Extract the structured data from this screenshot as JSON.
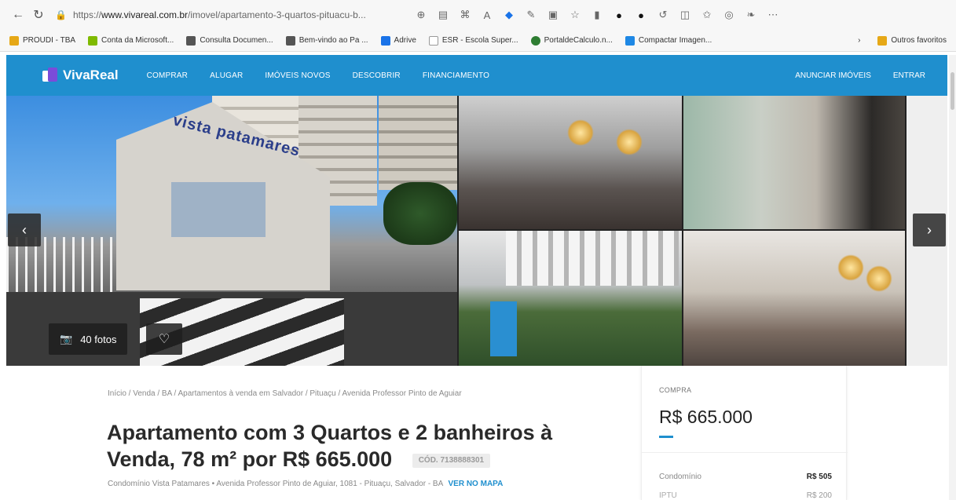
{
  "browser": {
    "url_prefix": "https://",
    "url_domain": "www.vivareal.com.br",
    "url_path": "/imovel/apartamento-3-quartos-pituacu-b..."
  },
  "bookmarks": [
    {
      "label": "PROUDI - TBA",
      "color": "#e6a817"
    },
    {
      "label": "Conta da Microsoft...",
      "color": "#7fba00"
    },
    {
      "label": "Consulta Documen...",
      "color": "#555555"
    },
    {
      "label": "Bem-vindo ao Pa ...",
      "color": "#555555"
    },
    {
      "label": "Adrive",
      "color": "#1a73e8"
    },
    {
      "label": "ESR - Escola Super...",
      "color": "#cccccc"
    },
    {
      "label": "PortaldeCalculo.n...",
      "color": "#2e7d32"
    },
    {
      "label": "Compactar Imagen...",
      "color": "#1e88e5"
    }
  ],
  "bookmarks_more": "Outros favoritos",
  "site": {
    "logo": "VivaReal",
    "nav": [
      "COMPRAR",
      "ALUGAR",
      "IMÓVEIS NOVOS",
      "DESCOBRIR",
      "FINANCIAMENTO"
    ],
    "nav_right": [
      "ANUNCIAR IMÓVEIS",
      "ENTRAR"
    ]
  },
  "gallery": {
    "sign_text": "vista patamares",
    "photos_count": "40 fotos",
    "prev_arrow": "‹",
    "next_arrow": "›"
  },
  "listing": {
    "breadcrumb": "Início / Venda / BA / Apartamentos à venda em Salvador / Pituaçu / Avenida Professor Pinto de Aguiar",
    "title": "Apartamento com 3 Quartos e 2 banheiros à Venda, 78 m² por R$ 665.000",
    "code": "CÓD. 7138888301",
    "address": "Condomínio Vista Patamares  •  Avenida Professor Pinto de Aguiar, 1081 - Pituaçu, Salvador - BA",
    "map_link": "VER NO MAPA"
  },
  "price_card": {
    "label": "COMPRA",
    "price": "R$ 665.000",
    "fees": [
      {
        "label": "Condomínio",
        "value": "R$ 505"
      },
      {
        "label": "IPTU",
        "value": "R$ 200"
      }
    ]
  },
  "colors": {
    "brand": "#1f8fce",
    "logo_accent": "#7b4cd9"
  }
}
